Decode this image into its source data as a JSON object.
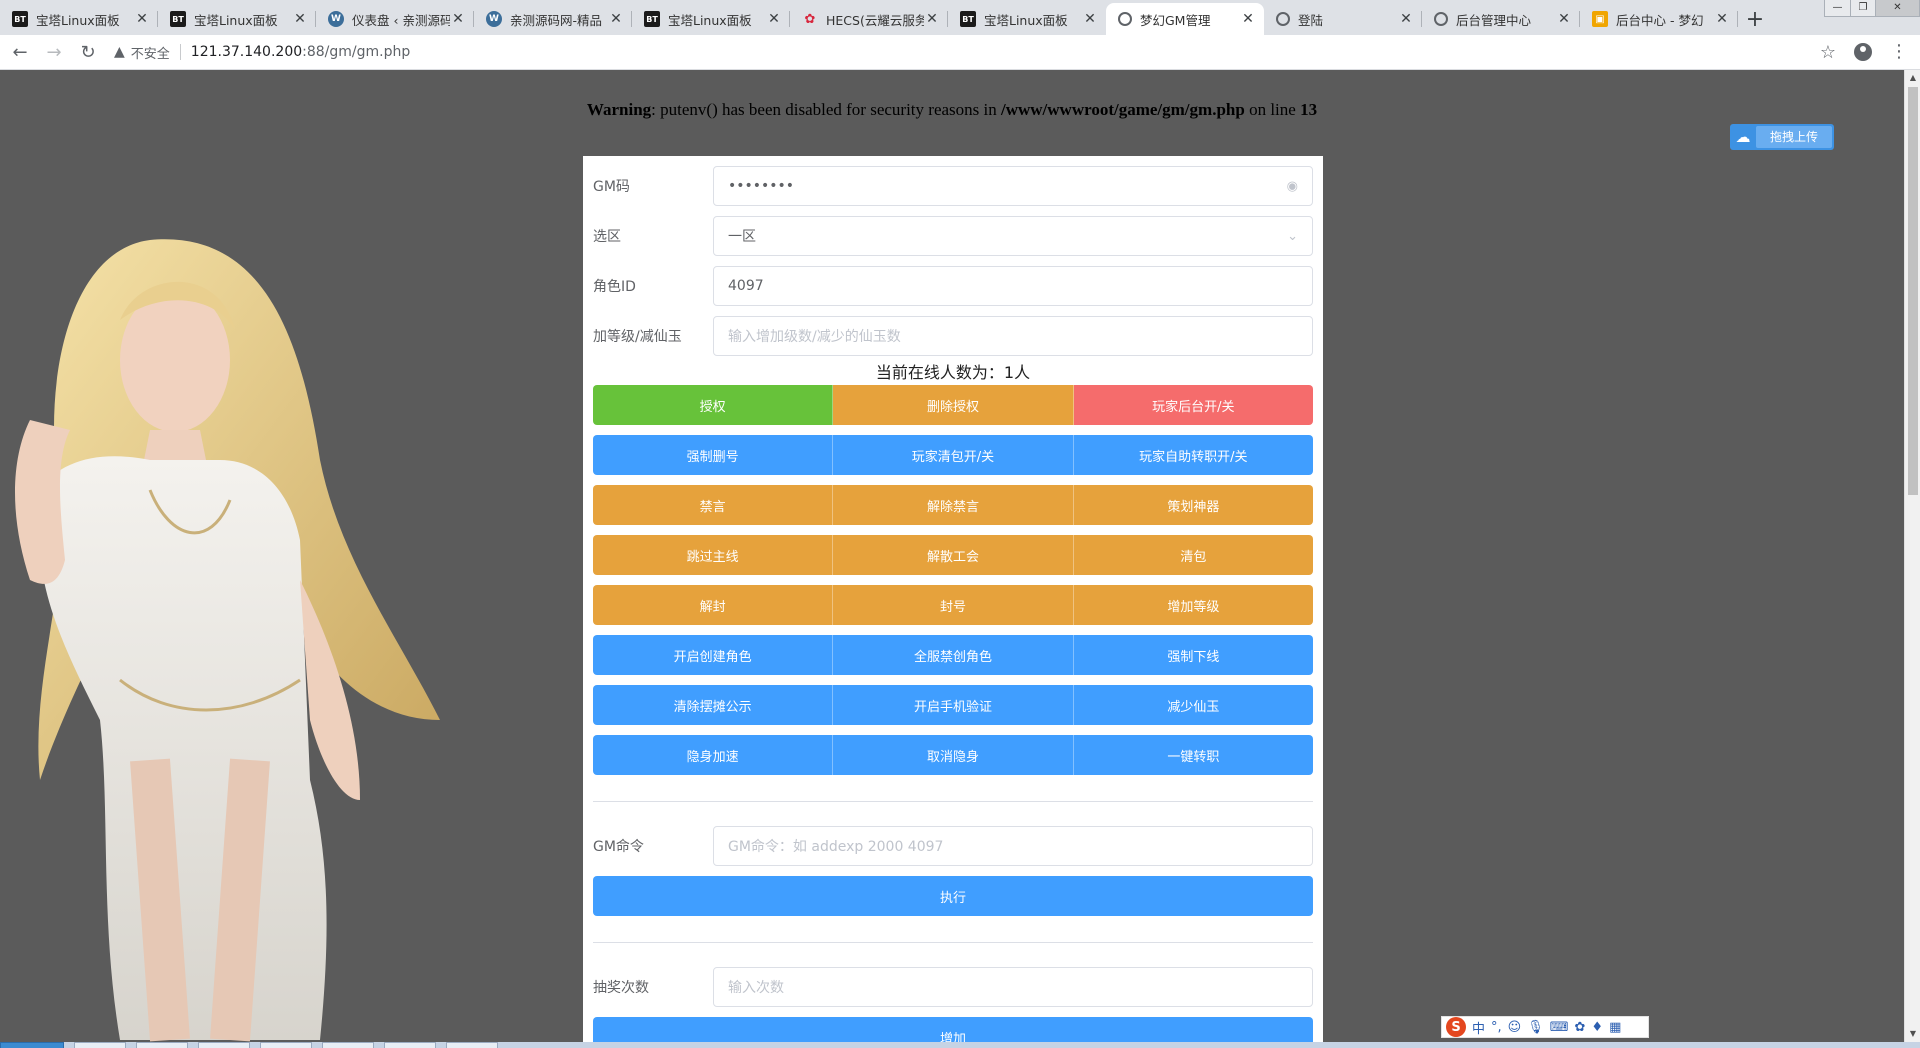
{
  "browser": {
    "tabs": [
      {
        "title": "宝塔Linux面板",
        "favicon": "bt-icon",
        "active": false
      },
      {
        "title": "宝塔Linux面板",
        "favicon": "bt-icon",
        "active": false
      },
      {
        "title": "仪表盘 ‹ 亲测源码",
        "favicon": "wordpress-icon",
        "active": false
      },
      {
        "title": "亲测源码网-精品",
        "favicon": "wordpress-icon",
        "active": false
      },
      {
        "title": "宝塔Linux面板",
        "favicon": "bt-icon",
        "active": false
      },
      {
        "title": "HECS(云耀云服务",
        "favicon": "huawei-icon",
        "active": false
      },
      {
        "title": "宝塔Linux面板",
        "favicon": "bt-icon",
        "active": false
      },
      {
        "title": "梦幻GM管理",
        "favicon": "globe-icon",
        "active": true
      },
      {
        "title": "登陆",
        "favicon": "globe-icon",
        "active": false
      },
      {
        "title": "后台管理中心",
        "favicon": "globe-icon",
        "active": false
      },
      {
        "title": "后台中心 - 梦幻",
        "favicon": "orange-icon",
        "active": false
      }
    ],
    "newtab_label": "+",
    "insecure_label": "不安全",
    "url_host": "121.37.140.200",
    "url_path": ":88/gm/gm.php"
  },
  "page": {
    "warning": {
      "prefix": "Warning",
      "message": ": putenv() has been disabled for security reasons in ",
      "path": "/www/wwwroot/game/gm/gm.php",
      "on_line": " on line ",
      "line": "13"
    },
    "upload_label": "拖拽上传",
    "form": {
      "gm_code_label": "GM码",
      "gm_code_value": "••••••••",
      "zone_label": "选区",
      "zone_value": "一区",
      "role_id_label": "角色ID",
      "role_id_value": "4097",
      "level_label": "加等级/减仙玉",
      "level_placeholder": "输入增加级数/减少的仙玉数"
    },
    "online_text": "当前在线人数为：1人",
    "button_rows": [
      [
        {
          "label": "授权",
          "color": "#67c23a"
        },
        {
          "label": "删除授权",
          "color": "#e6a23c"
        },
        {
          "label": "玩家后台开/关",
          "color": "#f56c6c"
        }
      ],
      [
        {
          "label": "强制删号",
          "color": "#409eff"
        },
        {
          "label": "玩家清包开/关",
          "color": "#409eff"
        },
        {
          "label": "玩家自助转职开/关",
          "color": "#409eff"
        }
      ],
      [
        {
          "label": "禁言",
          "color": "#e6a23c"
        },
        {
          "label": "解除禁言",
          "color": "#e6a23c"
        },
        {
          "label": "策划神器",
          "color": "#e6a23c"
        }
      ],
      [
        {
          "label": "跳过主线",
          "color": "#e6a23c"
        },
        {
          "label": "解散工会",
          "color": "#e6a23c"
        },
        {
          "label": "清包",
          "color": "#e6a23c"
        }
      ],
      [
        {
          "label": "解封",
          "color": "#e6a23c"
        },
        {
          "label": "封号",
          "color": "#e6a23c"
        },
        {
          "label": "增加等级",
          "color": "#e6a23c"
        }
      ],
      [
        {
          "label": "开启创建角色",
          "color": "#409eff"
        },
        {
          "label": "全服禁创角色",
          "color": "#409eff"
        },
        {
          "label": "强制下线",
          "color": "#409eff"
        }
      ],
      [
        {
          "label": "清除摆摊公示",
          "color": "#409eff"
        },
        {
          "label": "开启手机验证",
          "color": "#409eff"
        },
        {
          "label": "减少仙玉",
          "color": "#409eff"
        }
      ],
      [
        {
          "label": "隐身加速",
          "color": "#409eff"
        },
        {
          "label": "取消隐身",
          "color": "#409eff"
        },
        {
          "label": "一键转职",
          "color": "#409eff"
        }
      ]
    ],
    "gm_command": {
      "label": "GM命令",
      "placeholder": "GM命令：如 addexp 2000 4097",
      "execute_label": "执行"
    },
    "lottery": {
      "label": "抽奖次数",
      "placeholder": "输入次数",
      "add_label": "增加"
    }
  },
  "ime": {
    "logo": "S",
    "mode": "中"
  }
}
